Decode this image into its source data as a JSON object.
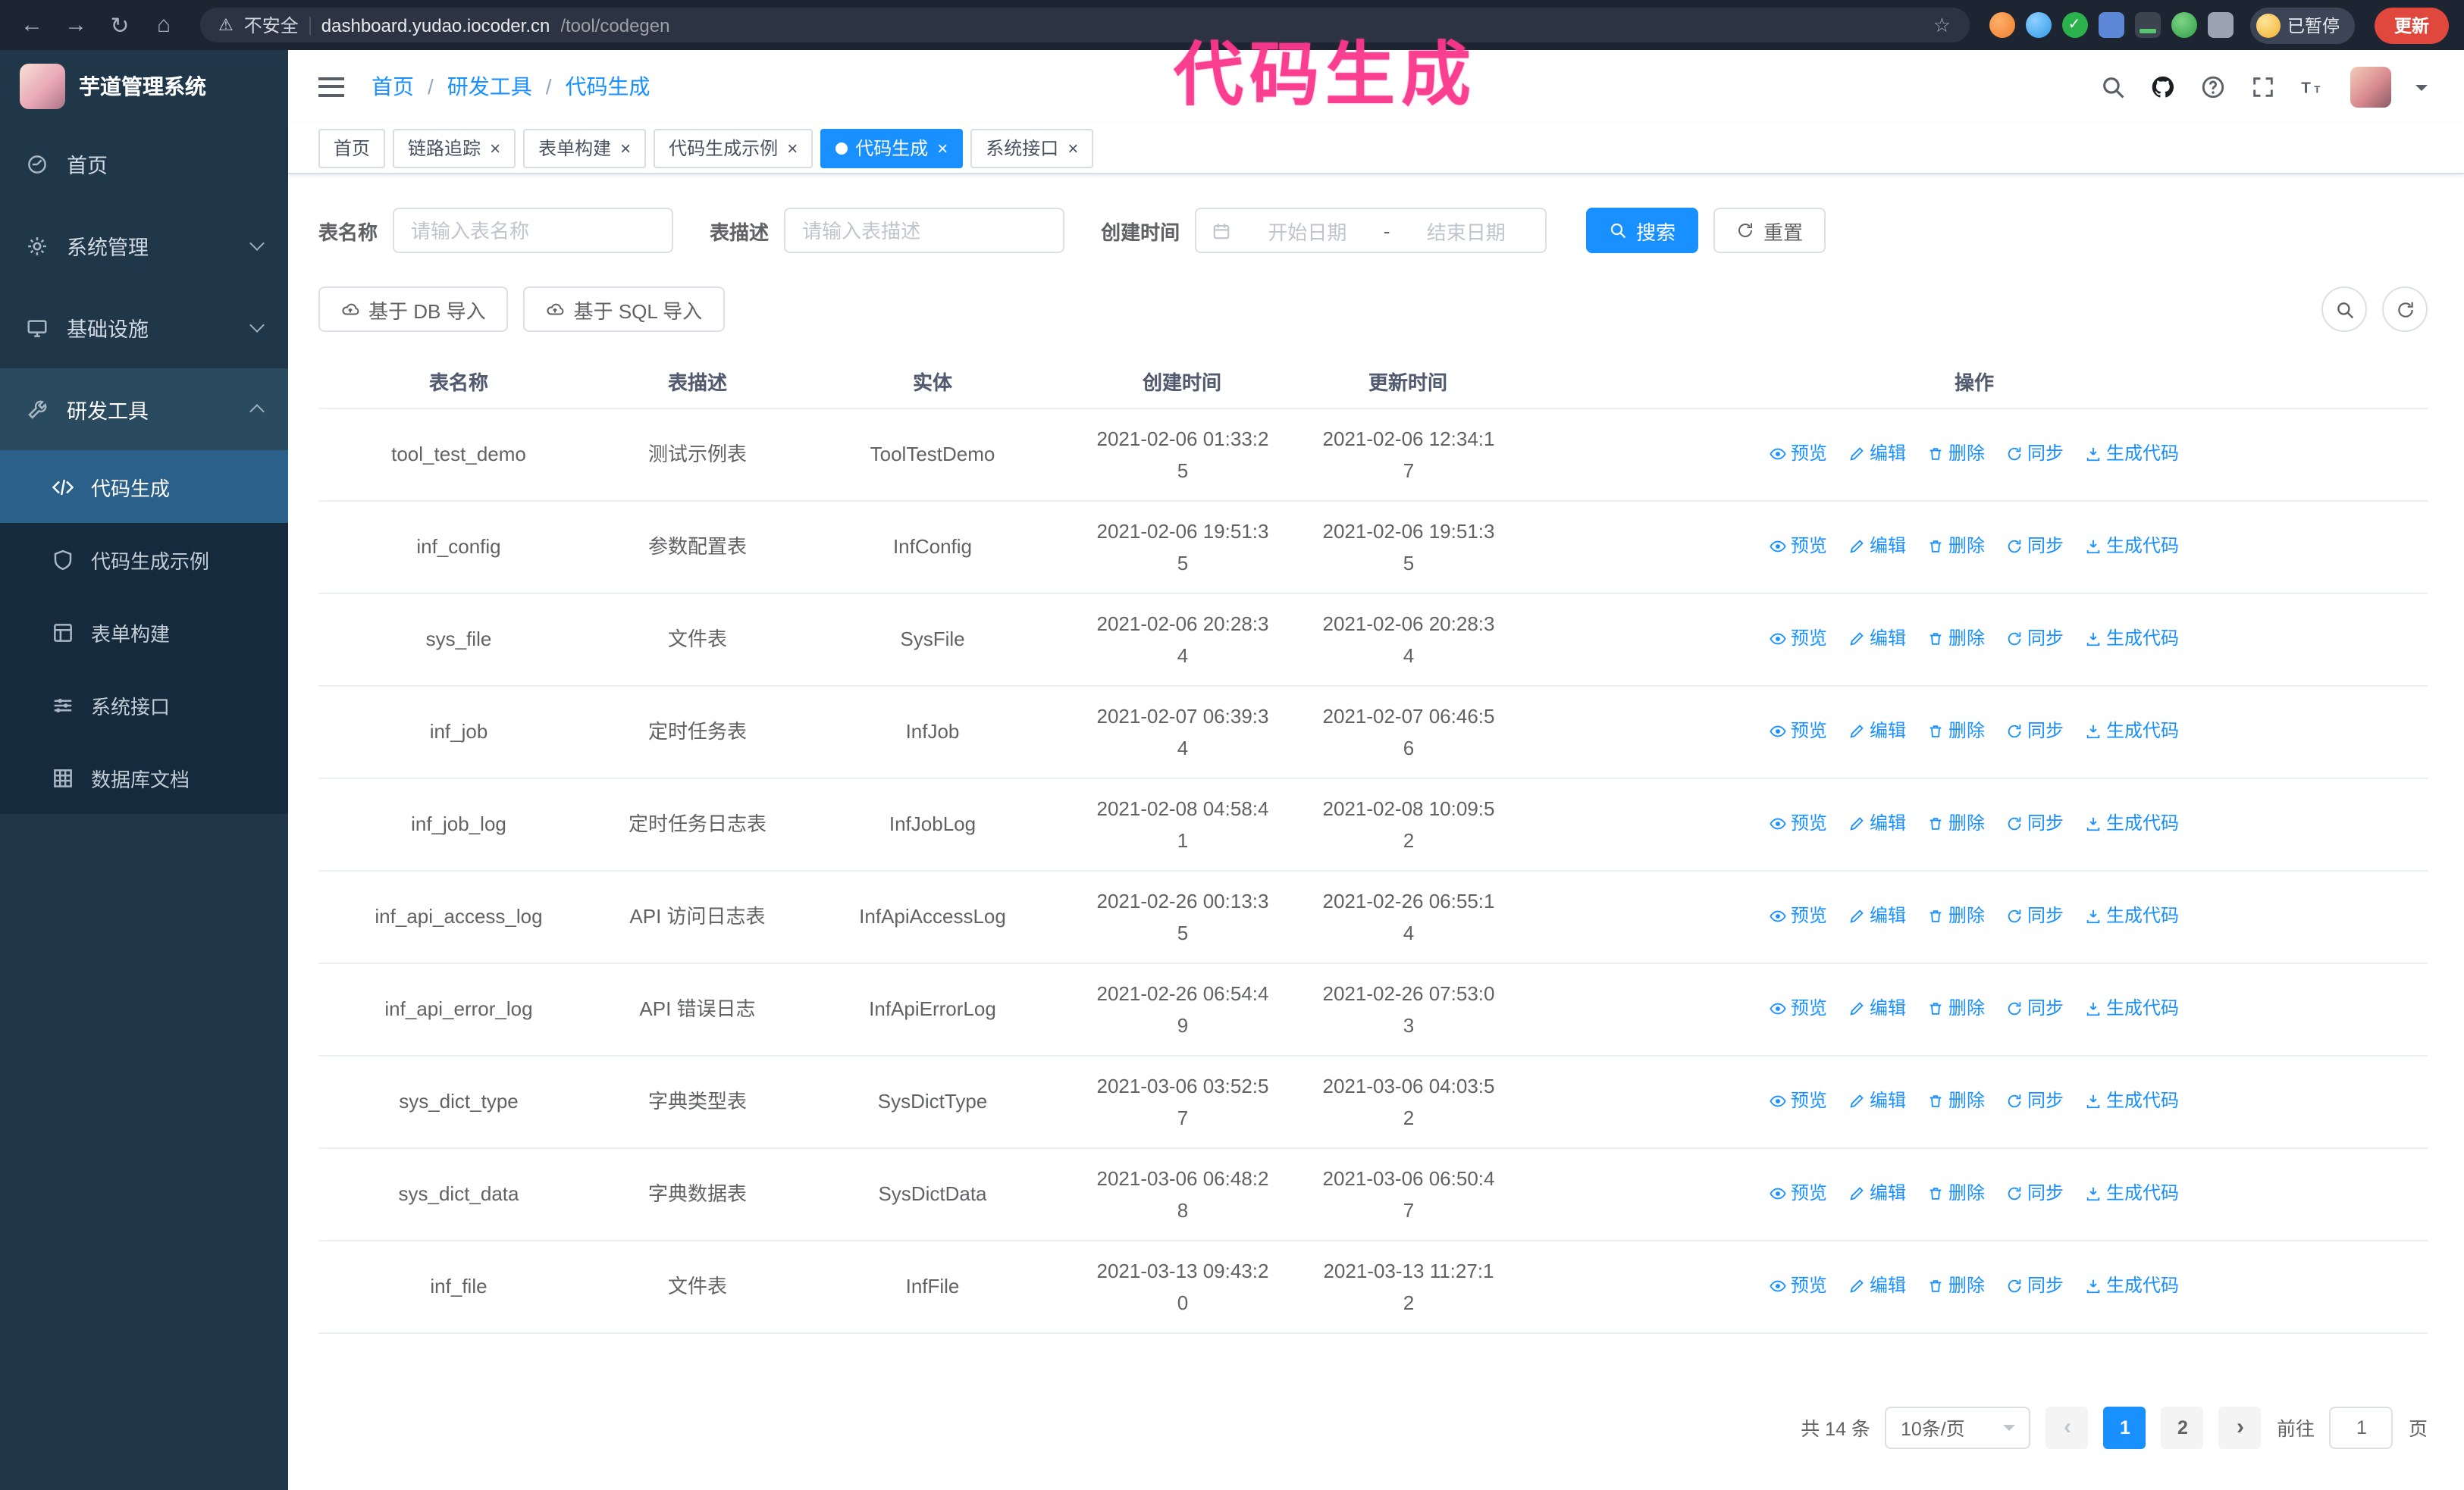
{
  "overlay": {
    "text": "代码生成"
  },
  "browser": {
    "security": "不安全",
    "url_host": "dashboard.yudao.iocoder.cn",
    "url_path": "/tool/codegen",
    "profile_badge": "已暂停",
    "update_button": "更新"
  },
  "sidebar": {
    "title": "芋道管理系统",
    "menu": [
      {
        "label": "首页",
        "icon": "dashboard-icon"
      },
      {
        "label": "系统管理",
        "icon": "gear-icon",
        "chevron": "down"
      },
      {
        "label": "基础设施",
        "icon": "monitor-icon",
        "chevron": "down"
      },
      {
        "label": "研发工具",
        "icon": "wrench-icon",
        "chevron": "up",
        "expanded": true
      }
    ],
    "submenu": [
      {
        "label": "代码生成",
        "icon": "code-icon",
        "active": true
      },
      {
        "label": "代码生成示例",
        "icon": "shield-icon",
        "active": false
      },
      {
        "label": "表单构建",
        "icon": "form-icon",
        "active": false
      },
      {
        "label": "系统接口",
        "icon": "sliders-icon",
        "active": false
      },
      {
        "label": "数据库文档",
        "icon": "grid-icon",
        "active": false
      }
    ]
  },
  "header": {
    "breadcrumb": [
      "首页",
      "研发工具",
      "代码生成"
    ]
  },
  "tabs": [
    {
      "label": "首页",
      "closable": false,
      "active": false
    },
    {
      "label": "链路追踪",
      "closable": true,
      "active": false
    },
    {
      "label": "表单构建",
      "closable": true,
      "active": false
    },
    {
      "label": "代码生成示例",
      "closable": true,
      "active": false
    },
    {
      "label": "代码生成",
      "closable": true,
      "active": true
    },
    {
      "label": "系统接口",
      "closable": true,
      "active": false
    }
  ],
  "filters": {
    "table_name_label": "表名称",
    "table_name_placeholder": "请输入表名称",
    "table_desc_label": "表描述",
    "table_desc_placeholder": "请输入表描述",
    "create_time_label": "创建时间",
    "date_start_placeholder": "开始日期",
    "date_separator": "-",
    "date_end_placeholder": "结束日期",
    "search_button": "搜索",
    "reset_button": "重置"
  },
  "toolbar": {
    "import_db_button": "基于 DB 导入",
    "import_sql_button": "基于 SQL 导入"
  },
  "table": {
    "columns": [
      "表名称",
      "表描述",
      "实体",
      "创建时间",
      "更新时间",
      "操作"
    ],
    "actions": [
      "预览",
      "编辑",
      "删除",
      "同步",
      "生成代码"
    ],
    "rows": [
      {
        "name": "tool_test_demo",
        "desc": "测试示例表",
        "entity": "ToolTestDemo",
        "created": "2021-02-06 01:33:25",
        "updated": "2021-02-06 12:34:17"
      },
      {
        "name": "inf_config",
        "desc": "参数配置表",
        "entity": "InfConfig",
        "created": "2021-02-06 19:51:35",
        "updated": "2021-02-06 19:51:35"
      },
      {
        "name": "sys_file",
        "desc": "文件表",
        "entity": "SysFile",
        "created": "2021-02-06 20:28:34",
        "updated": "2021-02-06 20:28:34"
      },
      {
        "name": "inf_job",
        "desc": "定时任务表",
        "entity": "InfJob",
        "created": "2021-02-07 06:39:34",
        "updated": "2021-02-07 06:46:56"
      },
      {
        "name": "inf_job_log",
        "desc": "定时任务日志表",
        "entity": "InfJobLog",
        "created": "2021-02-08 04:58:41",
        "updated": "2021-02-08 10:09:52"
      },
      {
        "name": "inf_api_access_log",
        "desc": "API 访问日志表",
        "entity": "InfApiAccessLog",
        "created": "2021-02-26 00:13:35",
        "updated": "2021-02-26 06:55:14"
      },
      {
        "name": "inf_api_error_log",
        "desc": "API 错误日志",
        "entity": "InfApiErrorLog",
        "created": "2021-02-26 06:54:49",
        "updated": "2021-02-26 07:53:03"
      },
      {
        "name": "sys_dict_type",
        "desc": "字典类型表",
        "entity": "SysDictType",
        "created": "2021-03-06 03:52:57",
        "updated": "2021-03-06 04:03:52"
      },
      {
        "name": "sys_dict_data",
        "desc": "字典数据表",
        "entity": "SysDictData",
        "created": "2021-03-06 06:48:28",
        "updated": "2021-03-06 06:50:47"
      },
      {
        "name": "inf_file",
        "desc": "文件表",
        "entity": "InfFile",
        "created": "2021-03-13 09:43:20",
        "updated": "2021-03-13 11:27:12"
      }
    ]
  },
  "pagination": {
    "total": "共 14 条",
    "page_size": "10条/页",
    "pages": [
      {
        "label": "1",
        "active": true
      },
      {
        "label": "2",
        "active": false
      }
    ],
    "goto_label": "前往",
    "goto_value": "1",
    "goto_suffix": "页"
  }
}
